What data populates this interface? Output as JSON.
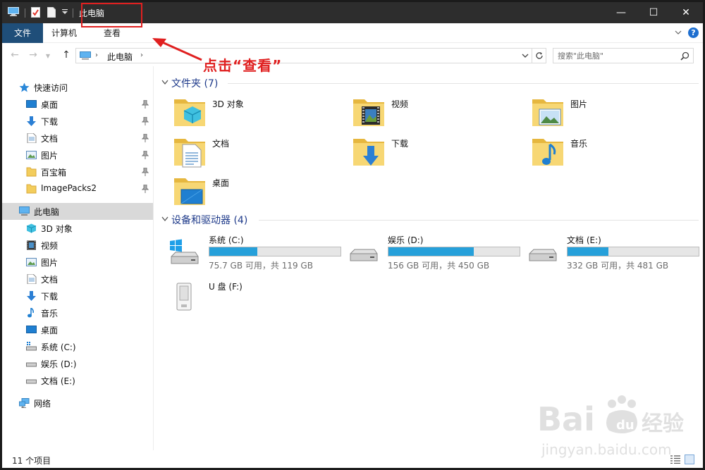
{
  "window": {
    "title": "此电脑",
    "controls": {
      "minimize": "—",
      "maximize": "☐",
      "close": "✕"
    }
  },
  "ribbon": {
    "tabs": [
      {
        "label": "文件"
      },
      {
        "label": "计算机"
      },
      {
        "label": "查看"
      }
    ],
    "help": "?"
  },
  "address": {
    "crumb": "此电脑",
    "search_placeholder": "搜索\"此电脑\""
  },
  "annotation": {
    "text": "点击“查看”"
  },
  "sidebar": {
    "quick_access": "快速访问",
    "pinned": [
      {
        "label": "桌面"
      },
      {
        "label": "下载"
      },
      {
        "label": "文档"
      },
      {
        "label": "图片"
      },
      {
        "label": "百宝箱"
      },
      {
        "label": "ImagePacks2"
      }
    ],
    "this_pc": "此电脑",
    "pc_items": [
      {
        "label": "3D 对象"
      },
      {
        "label": "视频"
      },
      {
        "label": "图片"
      },
      {
        "label": "文档"
      },
      {
        "label": "下载"
      },
      {
        "label": "音乐"
      },
      {
        "label": "桌面"
      },
      {
        "label": "系统 (C:)"
      },
      {
        "label": "娱乐 (D:)"
      },
      {
        "label": "文档 (E:)"
      }
    ],
    "network": "网络"
  },
  "folders": {
    "header": "文件夹 (7)",
    "items": [
      {
        "name": "3D 对象",
        "icon": "3d-objects-folder-icon"
      },
      {
        "name": "视频",
        "icon": "videos-folder-icon"
      },
      {
        "name": "图片",
        "icon": "pictures-folder-icon"
      },
      {
        "name": "文档",
        "icon": "documents-folder-icon"
      },
      {
        "name": "下载",
        "icon": "downloads-folder-icon"
      },
      {
        "name": "音乐",
        "icon": "music-folder-icon"
      },
      {
        "name": "桌面",
        "icon": "desktop-folder-icon"
      }
    ]
  },
  "drives": {
    "header": "设备和驱动器 (4)",
    "items": [
      {
        "name": "系统 (C:)",
        "space": "75.7 GB 可用，共 119 GB",
        "used_fraction": 0.364
      },
      {
        "name": "娱乐 (D:)",
        "space": "156 GB 可用，共 450 GB",
        "used_fraction": 0.653
      },
      {
        "name": "文档 (E:)",
        "space": "332 GB 可用，共 481 GB",
        "used_fraction": 0.31
      },
      {
        "name": "U 盘 (F:)"
      }
    ]
  },
  "status": {
    "count": "11 个项目"
  },
  "colors": {
    "accent": "#1f4e79",
    "drive_fill": "#26a0da",
    "annotation": "#e02020",
    "header_text": "#1e3a8a"
  }
}
